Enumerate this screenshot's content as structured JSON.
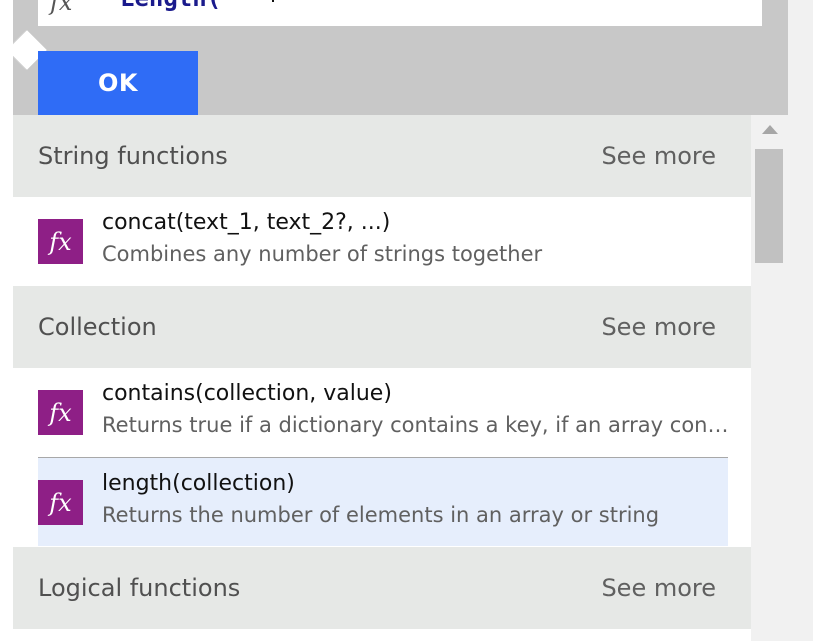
{
  "expression": {
    "fx_symbol": "fx",
    "text": "Length("
  },
  "ok_button": {
    "label": "OK"
  },
  "sections": [
    {
      "title": "String functions",
      "see_more": "See more",
      "items": [
        {
          "icon": "fx",
          "name": "concat(text_1, text_2?, ...)",
          "description": "Combines any number of strings together"
        }
      ]
    },
    {
      "title": "Collection",
      "see_more": "See more",
      "items": [
        {
          "icon": "fx",
          "name": "contains(collection, value)",
          "description": "Returns true if a dictionary contains a key, if an array contains a value, or if a string contains a substring."
        },
        {
          "icon": "fx",
          "name": "length(collection)",
          "description": "Returns the number of elements in an array or string",
          "selected": true
        }
      ]
    },
    {
      "title": "Logical functions",
      "see_more": "See more",
      "items": []
    }
  ],
  "colors": {
    "ok_button": "#2f6cf6",
    "fx_icon": "#8e1f86",
    "selected_row": "#e6eefc",
    "section_header": "#e6e8e6"
  }
}
